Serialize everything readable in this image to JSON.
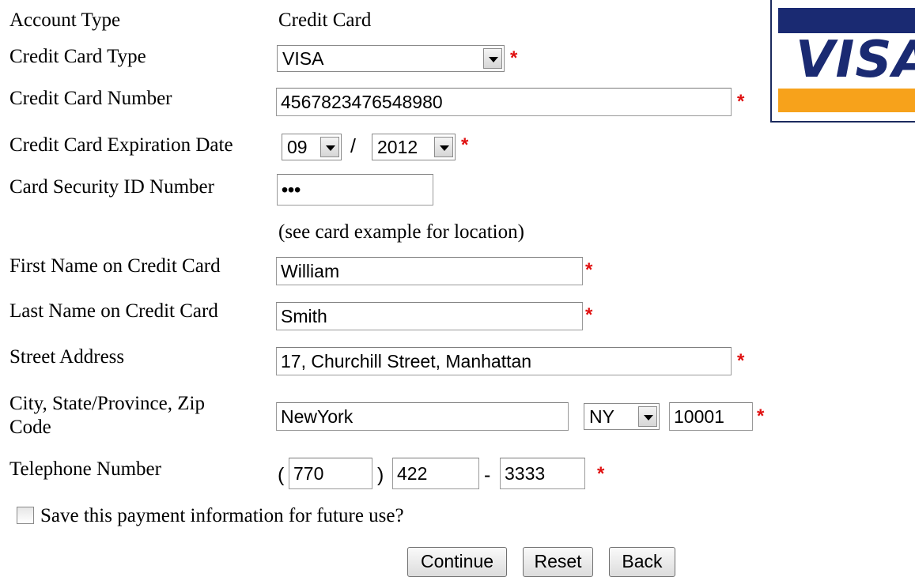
{
  "account_type": {
    "label": "Account Type",
    "value": "Credit Card"
  },
  "card_type": {
    "label": "Credit Card Type",
    "selected": "VISA"
  },
  "card_number": {
    "label": "Credit Card Number",
    "value": "4567823476548980"
  },
  "expiration": {
    "label": "Credit Card Expiration Date",
    "month": "09",
    "separator": "/",
    "year": "2012"
  },
  "security_id": {
    "label": "Card Security ID Number",
    "value": "•••",
    "hint": "(see card example for location)"
  },
  "first_name": {
    "label": "First Name on Credit Card",
    "value": "William"
  },
  "last_name": {
    "label": "Last Name on Credit Card",
    "value": "Smith"
  },
  "street": {
    "label": "Street Address",
    "value": "17, Churchill Street, Manhattan"
  },
  "city_state_zip": {
    "label": "City, State/Province, Zip Code",
    "city": "NewYork",
    "state": "NY",
    "zip": "10001"
  },
  "telephone": {
    "label": "Telephone Number",
    "open_paren": "(",
    "area": "770",
    "close_paren": ")",
    "prefix": "422",
    "dash": "-",
    "line": "3333"
  },
  "save_payment": {
    "label": "Save this payment information for future use?",
    "checked": false
  },
  "required_marker": "*",
  "buttons": {
    "continue": "Continue",
    "reset": "Reset",
    "back": "Back"
  },
  "logo": {
    "brand": "VISA",
    "colors": {
      "blue": "#1a2a72",
      "orange": "#f7a21b"
    }
  },
  "colors": {
    "required": "#e01010"
  }
}
